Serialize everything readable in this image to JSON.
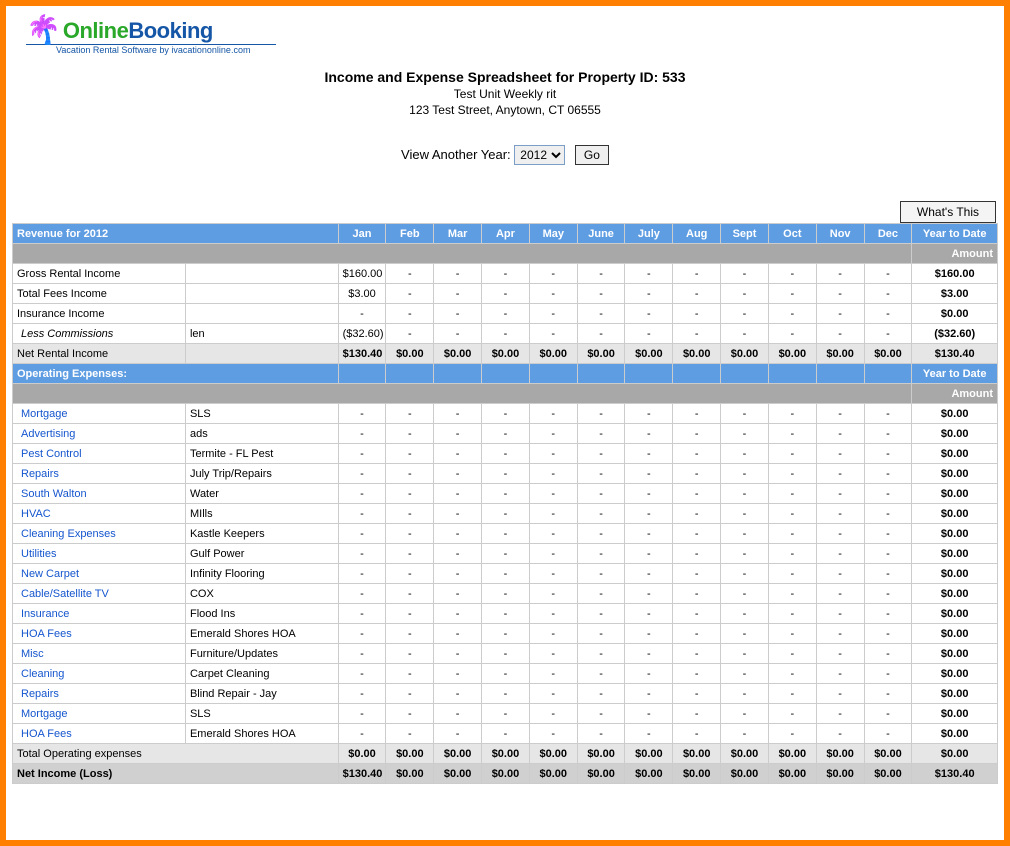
{
  "logo": {
    "online": "Online",
    "booking": "Booking",
    "sub": "Vacation Rental Software by ivacationonline.com"
  },
  "header": {
    "title": "Income and Expense Spreadsheet for Property ID: 533",
    "unit": "Test Unit Weekly rit",
    "address": "123 Test Street, Anytown, CT 06555"
  },
  "yearSelector": {
    "label": "View Another Year:",
    "value": "2012",
    "go": "Go"
  },
  "whatsThis": "What's This",
  "months": [
    "Jan",
    "Feb",
    "Mar",
    "Apr",
    "May",
    "June",
    "July",
    "Aug",
    "Sept",
    "Oct",
    "Nov",
    "Dec"
  ],
  "revenueHeader": "Revenue for 2012",
  "ytdHeader": "Year to Date",
  "amountLabel": "Amount",
  "revenueRows": [
    {
      "label": "Gross Rental Income",
      "vendor": "",
      "months": [
        "$160.00",
        "-",
        "-",
        "-",
        "-",
        "-",
        "-",
        "-",
        "-",
        "-",
        "-",
        "-"
      ],
      "ytd": "$160.00"
    },
    {
      "label": "Total Fees Income",
      "vendor": "",
      "months": [
        "$3.00",
        "-",
        "-",
        "-",
        "-",
        "-",
        "-",
        "-",
        "-",
        "-",
        "-",
        "-"
      ],
      "ytd": "$3.00"
    },
    {
      "label": "Insurance Income",
      "vendor": "",
      "months": [
        "-",
        "-",
        "-",
        "-",
        "-",
        "-",
        "-",
        "-",
        "-",
        "-",
        "-",
        "-"
      ],
      "ytd": "$0.00"
    },
    {
      "label": "Less Commissions",
      "vendor": "len",
      "italic": true,
      "months": [
        "($32.60)",
        "-",
        "-",
        "-",
        "-",
        "-",
        "-",
        "-",
        "-",
        "-",
        "-",
        "-"
      ],
      "ytd": "($32.60)"
    }
  ],
  "netRental": {
    "label": "Net Rental Income",
    "months": [
      "$130.40",
      "$0.00",
      "$0.00",
      "$0.00",
      "$0.00",
      "$0.00",
      "$0.00",
      "$0.00",
      "$0.00",
      "$0.00",
      "$0.00",
      "$0.00"
    ],
    "ytd": "$130.40"
  },
  "opHeader": "Operating Expenses:",
  "expenseRows": [
    {
      "label": "Mortgage",
      "vendor": "SLS",
      "months": [
        "-",
        "-",
        "-",
        "-",
        "-",
        "-",
        "-",
        "-",
        "-",
        "-",
        "-",
        "-"
      ],
      "ytd": "$0.00"
    },
    {
      "label": "Advertising",
      "vendor": "ads",
      "months": [
        "-",
        "-",
        "-",
        "-",
        "-",
        "-",
        "-",
        "-",
        "-",
        "-",
        "-",
        "-"
      ],
      "ytd": "$0.00"
    },
    {
      "label": "Pest Control",
      "vendor": "Termite - FL Pest",
      "months": [
        "-",
        "-",
        "-",
        "-",
        "-",
        "-",
        "-",
        "-",
        "-",
        "-",
        "-",
        "-"
      ],
      "ytd": "$0.00"
    },
    {
      "label": "Repairs",
      "vendor": "July Trip/Repairs",
      "months": [
        "-",
        "-",
        "-",
        "-",
        "-",
        "-",
        "-",
        "-",
        "-",
        "-",
        "-",
        "-"
      ],
      "ytd": "$0.00"
    },
    {
      "label": "South Walton",
      "vendor": "Water",
      "months": [
        "-",
        "-",
        "-",
        "-",
        "-",
        "-",
        "-",
        "-",
        "-",
        "-",
        "-",
        "-"
      ],
      "ytd": "$0.00"
    },
    {
      "label": "HVAC",
      "vendor": "MIlls",
      "months": [
        "-",
        "-",
        "-",
        "-",
        "-",
        "-",
        "-",
        "-",
        "-",
        "-",
        "-",
        "-"
      ],
      "ytd": "$0.00"
    },
    {
      "label": "Cleaning Expenses",
      "vendor": "Kastle Keepers",
      "months": [
        "-",
        "-",
        "-",
        "-",
        "-",
        "-",
        "-",
        "-",
        "-",
        "-",
        "-",
        "-"
      ],
      "ytd": "$0.00"
    },
    {
      "label": "Utilities",
      "vendor": "Gulf Power",
      "months": [
        "-",
        "-",
        "-",
        "-",
        "-",
        "-",
        "-",
        "-",
        "-",
        "-",
        "-",
        "-"
      ],
      "ytd": "$0.00"
    },
    {
      "label": "New Carpet",
      "vendor": "Infinity Flooring",
      "months": [
        "-",
        "-",
        "-",
        "-",
        "-",
        "-",
        "-",
        "-",
        "-",
        "-",
        "-",
        "-"
      ],
      "ytd": "$0.00"
    },
    {
      "label": "Cable/Satellite TV",
      "vendor": "COX",
      "months": [
        "-",
        "-",
        "-",
        "-",
        "-",
        "-",
        "-",
        "-",
        "-",
        "-",
        "-",
        "-"
      ],
      "ytd": "$0.00"
    },
    {
      "label": "Insurance",
      "vendor": "Flood Ins",
      "months": [
        "-",
        "-",
        "-",
        "-",
        "-",
        "-",
        "-",
        "-",
        "-",
        "-",
        "-",
        "-"
      ],
      "ytd": "$0.00"
    },
    {
      "label": "HOA Fees",
      "vendor": "Emerald Shores HOA",
      "months": [
        "-",
        "-",
        "-",
        "-",
        "-",
        "-",
        "-",
        "-",
        "-",
        "-",
        "-",
        "-"
      ],
      "ytd": "$0.00"
    },
    {
      "label": "Misc",
      "vendor": "Furniture/Updates",
      "months": [
        "-",
        "-",
        "-",
        "-",
        "-",
        "-",
        "-",
        "-",
        "-",
        "-",
        "-",
        "-"
      ],
      "ytd": "$0.00"
    },
    {
      "label": "Cleaning",
      "vendor": "Carpet Cleaning",
      "months": [
        "-",
        "-",
        "-",
        "-",
        "-",
        "-",
        "-",
        "-",
        "-",
        "-",
        "-",
        "-"
      ],
      "ytd": "$0.00"
    },
    {
      "label": "Repairs",
      "vendor": "Blind Repair - Jay",
      "months": [
        "-",
        "-",
        "-",
        "-",
        "-",
        "-",
        "-",
        "-",
        "-",
        "-",
        "-",
        "-"
      ],
      "ytd": "$0.00"
    },
    {
      "label": "Mortgage",
      "vendor": "SLS",
      "months": [
        "-",
        "-",
        "-",
        "-",
        "-",
        "-",
        "-",
        "-",
        "-",
        "-",
        "-",
        "-"
      ],
      "ytd": "$0.00"
    },
    {
      "label": "HOA Fees",
      "vendor": "Emerald Shores HOA",
      "months": [
        "-",
        "-",
        "-",
        "-",
        "-",
        "-",
        "-",
        "-",
        "-",
        "-",
        "-",
        "-"
      ],
      "ytd": "$0.00"
    }
  ],
  "totalOp": {
    "label": "Total Operating expenses",
    "months": [
      "$0.00",
      "$0.00",
      "$0.00",
      "$0.00",
      "$0.00",
      "$0.00",
      "$0.00",
      "$0.00",
      "$0.00",
      "$0.00",
      "$0.00",
      "$0.00"
    ],
    "ytd": "$0.00"
  },
  "netIncome": {
    "label": "Net Income (Loss)",
    "months": [
      "$130.40",
      "$0.00",
      "$0.00",
      "$0.00",
      "$0.00",
      "$0.00",
      "$0.00",
      "$0.00",
      "$0.00",
      "$0.00",
      "$0.00",
      "$0.00"
    ],
    "ytd": "$130.40"
  }
}
